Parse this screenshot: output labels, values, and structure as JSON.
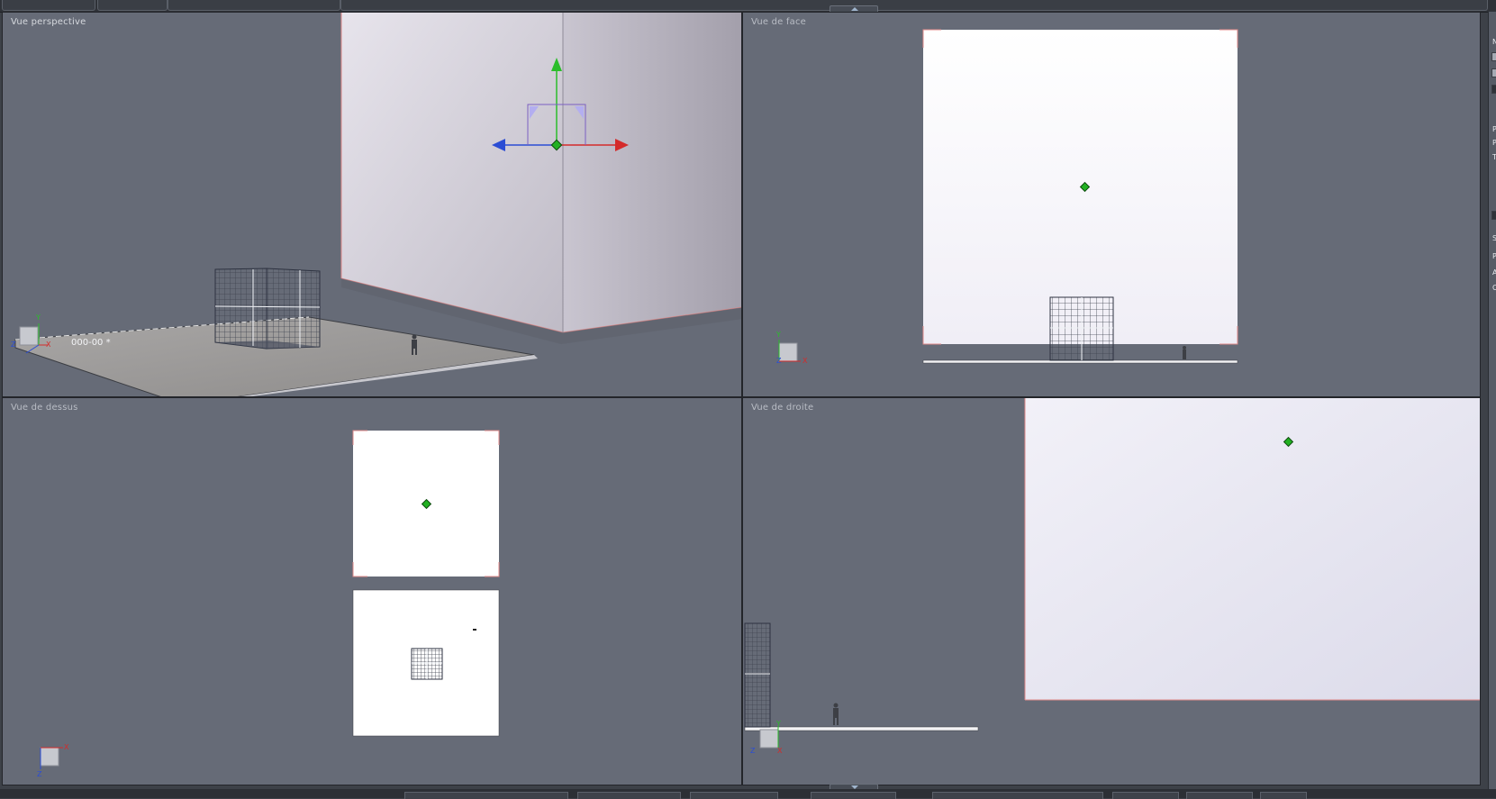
{
  "viewports": {
    "perspective": {
      "label": "Vue perspective",
      "object_label": "000-00 *"
    },
    "front": {
      "label": "Vue de face"
    },
    "top": {
      "label": "Vue de dessus"
    },
    "right": {
      "label": "Vue de droite"
    }
  },
  "axis_labels": {
    "x": "X",
    "y": "Y",
    "z": "Z"
  },
  "right_panel": {
    "glyphs": [
      "N",
      "P",
      "P",
      "T",
      "S",
      "P",
      "A",
      "C"
    ]
  },
  "colors": {
    "viewport_bg": "#666b77",
    "axis_x": "#d42b2b",
    "axis_y": "#2bbd2b",
    "axis_z": "#2b4dd4",
    "pivot": "#22b022",
    "selection_edge": "#e08a8a"
  },
  "icons": [
    "move-gizmo-icon",
    "pivot-icon",
    "axis-triad-icon",
    "human-scale-figure-icon",
    "collapse-arrow-icon"
  ]
}
